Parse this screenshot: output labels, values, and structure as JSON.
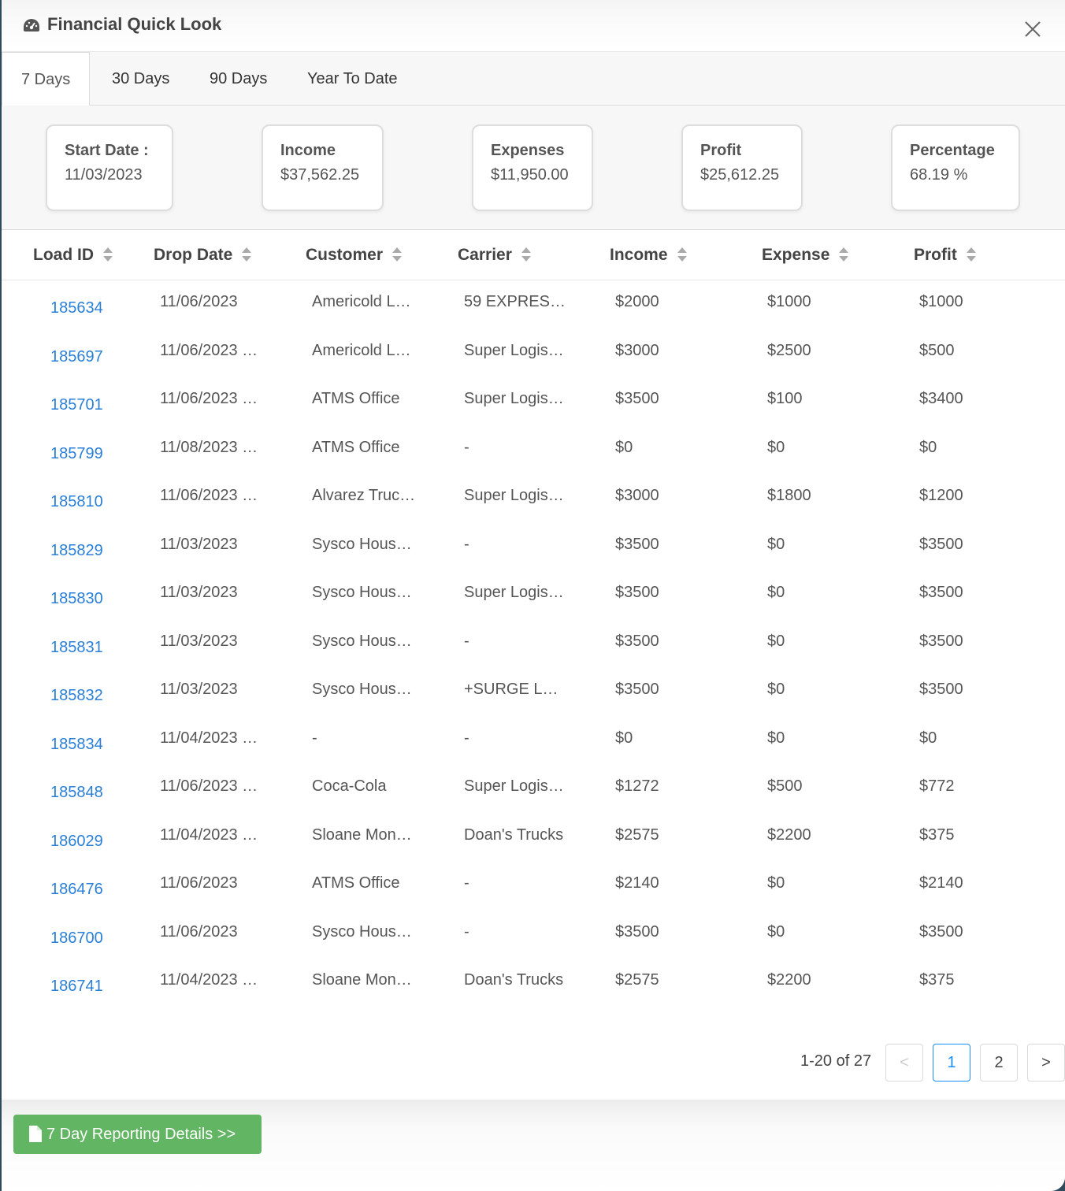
{
  "modal": {
    "title": "Financial Quick Look"
  },
  "tabs": [
    {
      "label": "7 Days",
      "active": true
    },
    {
      "label": "30 Days",
      "active": false
    },
    {
      "label": "90 Days",
      "active": false
    },
    {
      "label": "Year To Date",
      "active": false
    }
  ],
  "summary": {
    "start_date": {
      "label": "Start Date :",
      "value": "11/03/2023"
    },
    "income": {
      "label": "Income",
      "value": "$37,562.25"
    },
    "expenses": {
      "label": "Expenses",
      "value": "$11,950.00"
    },
    "profit": {
      "label": "Profit",
      "value": "$25,612.25"
    },
    "percentage": {
      "label": "Percentage",
      "value": "68.19 %"
    }
  },
  "table": {
    "columns": [
      "Load ID",
      "Drop Date",
      "Customer",
      "Carrier",
      "Income",
      "Expense",
      "Profit"
    ],
    "rows": [
      [
        "185634",
        "11/06/2023",
        "Americold L…",
        "59 EXPRES…",
        "$2000",
        "$1000",
        "$1000"
      ],
      [
        "185697",
        "11/06/2023 …",
        "Americold L…",
        "Super Logis…",
        "$3000",
        "$2500",
        "$500"
      ],
      [
        "185701",
        "11/06/2023 …",
        "ATMS Office",
        "Super Logis…",
        "$3500",
        "$100",
        "$3400"
      ],
      [
        "185799",
        "11/08/2023 …",
        "ATMS Office",
        "-",
        "$0",
        "$0",
        "$0"
      ],
      [
        "185810",
        "11/06/2023 …",
        "Alvarez Truc…",
        "Super Logis…",
        "$3000",
        "$1800",
        "$1200"
      ],
      [
        "185829",
        "11/03/2023",
        "Sysco Hous…",
        "-",
        "$3500",
        "$0",
        "$3500"
      ],
      [
        "185830",
        "11/03/2023",
        "Sysco Hous…",
        "Super Logis…",
        "$3500",
        "$0",
        "$3500"
      ],
      [
        "185831",
        "11/03/2023",
        "Sysco Hous…",
        "-",
        "$3500",
        "$0",
        "$3500"
      ],
      [
        "185832",
        "11/03/2023",
        "Sysco Hous…",
        "+SURGE L…",
        "$3500",
        "$0",
        "$3500"
      ],
      [
        "185834",
        "11/04/2023 …",
        "-",
        "-",
        "$0",
        "$0",
        "$0"
      ],
      [
        "185848",
        "11/06/2023 …",
        "Coca-Cola",
        "Super Logis…",
        "$1272",
        "$500",
        "$772"
      ],
      [
        "186029",
        "11/04/2023 …",
        "Sloane Mon…",
        "Doan's Trucks",
        "$2575",
        "$2200",
        "$375"
      ],
      [
        "186476",
        "11/06/2023",
        "ATMS Office",
        "-",
        "$2140",
        "$0",
        "$2140"
      ],
      [
        "186700",
        "11/06/2023",
        "Sysco Hous…",
        "-",
        "$3500",
        "$0",
        "$3500"
      ],
      [
        "186741",
        "11/04/2023 …",
        "Sloane Mon…",
        "Doan's Trucks",
        "$2575",
        "$2200",
        "$375"
      ]
    ]
  },
  "pagination": {
    "range_text": "1-20 of 27",
    "prev": "<",
    "pages": [
      "1",
      "2"
    ],
    "current_page": "1",
    "next": ">"
  },
  "footer": {
    "report_button": "7 Day Reporting Details >>"
  },
  "colors": {
    "link": "#2a7fd6",
    "button_green": "#62b562",
    "page_active": "#1890ff"
  }
}
